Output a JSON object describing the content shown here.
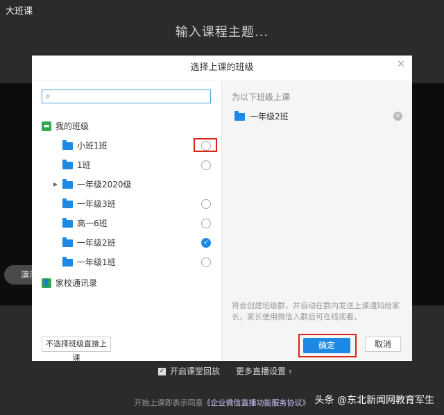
{
  "app": {
    "title": "大班课",
    "topic_placeholder": "输入课程主题..."
  },
  "background": {
    "pill_text": "演示"
  },
  "bottom": {
    "record_checkbox_label": "开启课堂回放",
    "more_settings": "更多直播设置 ›",
    "agreement_prefix": "开始上课即表示同意",
    "agreement_link": "《企业微信直播功能服务协议》"
  },
  "watermark": "头条 @东北新闻网教育军生",
  "dialog": {
    "title": "选择上课的班级",
    "search": {
      "value": "",
      "placeholder": ""
    },
    "tree": {
      "root_label": "我的班级",
      "items": [
        {
          "label": "小班1班"
        },
        {
          "label": "1班"
        },
        {
          "label": "一年级2020级"
        },
        {
          "label": "一年级3班"
        },
        {
          "label": "高一6班"
        },
        {
          "label": "一年级2班"
        },
        {
          "label": "一年级1班"
        }
      ],
      "contacts_label": "家校通讯录"
    },
    "right": {
      "title": "为以下班级上课",
      "selected": [
        {
          "label": "一年级2班"
        }
      ],
      "note": "将会创建班级群，并自动在群内发送上课通知给家长，家长使用微信入群后可在线观看。"
    },
    "buttons": {
      "no_class": "不选择班级直接上课",
      "confirm": "确定",
      "cancel": "取消"
    }
  },
  "colors": {
    "accent": "#1e88e5",
    "highlight": "#d9231d",
    "badge_green": "#2fa84f"
  }
}
